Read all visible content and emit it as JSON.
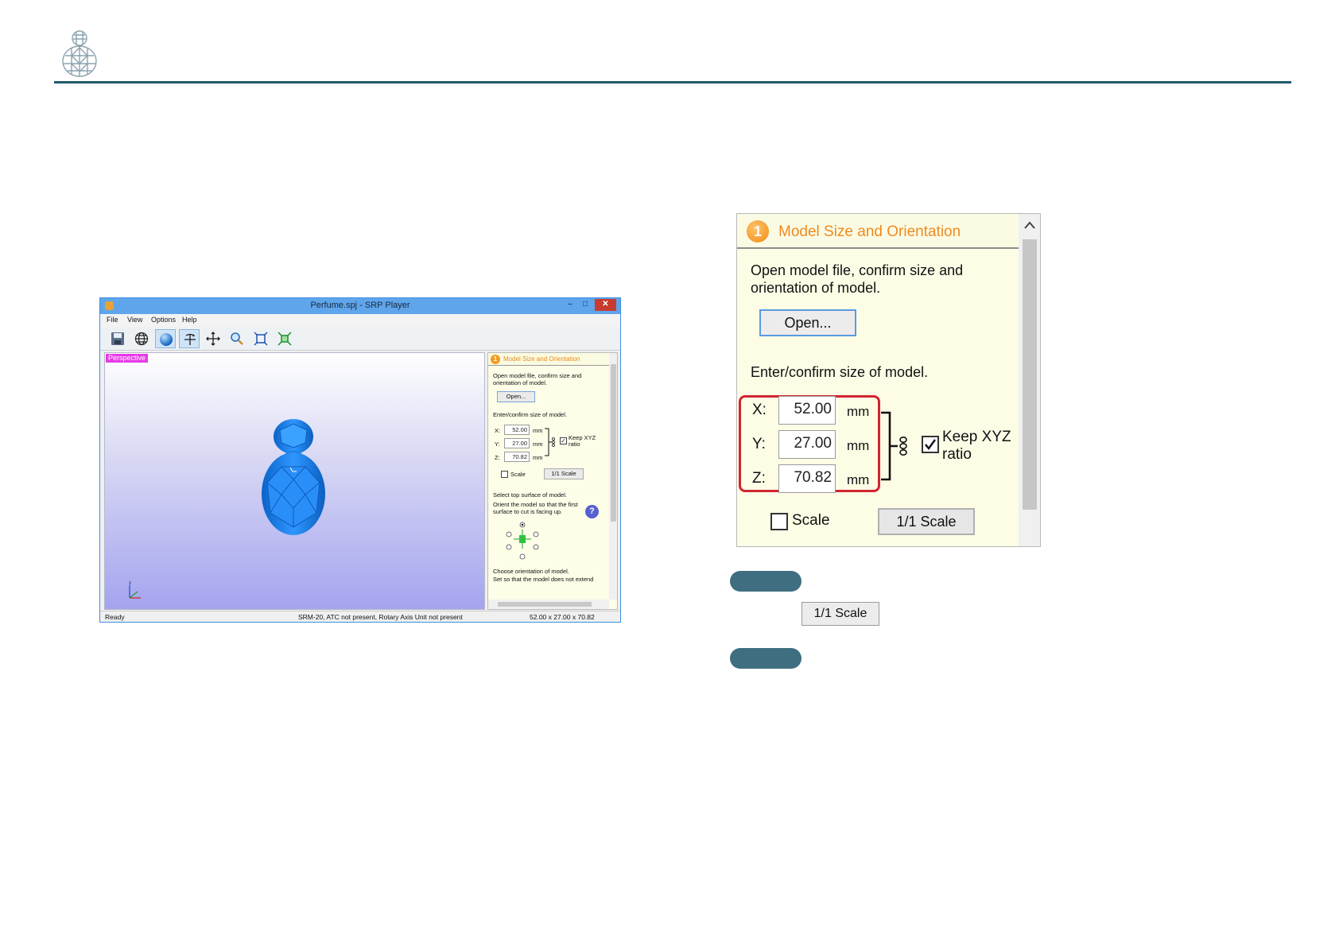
{
  "window": {
    "title": "Perfume.spj - SRP Player",
    "controls": {
      "minimize": "–",
      "maximize": "□",
      "close": "✕"
    },
    "menu": [
      "File",
      "View",
      "Options",
      "Help"
    ],
    "toolbar_icons": [
      "save-icon",
      "wireframe-globe-icon",
      "shaded-sphere-icon",
      "rotate-view-icon",
      "pan-icon",
      "zoom-icon",
      "fit-view-icon",
      "fit-model-icon"
    ],
    "viewport_label": "Perspective",
    "panel": {
      "step_number": "1",
      "title": "Model Size and Orientation",
      "intro": "Open model file, confirm size and orientation of model.",
      "open_button": "Open...",
      "size_heading": "Enter/confirm size of model.",
      "axes": [
        {
          "label": "X:",
          "value": "52.00",
          "unit": "mm"
        },
        {
          "label": "Y:",
          "value": "27.00",
          "unit": "mm"
        },
        {
          "label": "Z:",
          "value": "70.82",
          "unit": "mm"
        }
      ],
      "keep_ratio_label": "Keep XYZ ratio",
      "keep_ratio_checked": true,
      "scale_label": "Scale",
      "scale_checked": false,
      "scale_button": "1/1 Scale",
      "top_surface_heading": "Select top surface of model.",
      "top_surface_text": "Orient the model so that the first surface to cut is facing up.",
      "help_glyph": "?",
      "orientation_heading": "Choose orientation of model.",
      "orientation_text": "Set so that the model does not extend"
    },
    "status": {
      "left": "Ready",
      "middle": "SRM-20, ATC not present, Rotary Axis Unit not present",
      "right": "52.00 x  27.00 x  70.82"
    }
  },
  "zoom_panel": {
    "step_number": "1",
    "title": "Model Size and Orientation",
    "intro_line1": "Open model file, confirm size and",
    "intro_line2": "orientation of model.",
    "open_button": "Open...",
    "size_heading": "Enter/confirm size of model.",
    "axes": [
      {
        "label": "X:",
        "value": "52.00",
        "unit": "mm"
      },
      {
        "label": "Y:",
        "value": "27.00",
        "unit": "mm"
      },
      {
        "label": "Z:",
        "value": "70.82",
        "unit": "mm"
      }
    ],
    "keep_ratio_line1": "Keep XYZ",
    "keep_ratio_line2": "ratio",
    "keep_ratio_checked": true,
    "scale_label": "Scale",
    "scale_checked": false,
    "scale_button": "1/1 Scale"
  },
  "notes": {
    "inline_button": "1/1 Scale"
  },
  "colors": {
    "header_rule": "#1f5a6e",
    "pill": "#3f6e80",
    "panel_title": "#ef8a1f",
    "highlight_box": "#d02531",
    "model_blue": "#1f86f0",
    "perspective_tag": "#e53be5"
  }
}
